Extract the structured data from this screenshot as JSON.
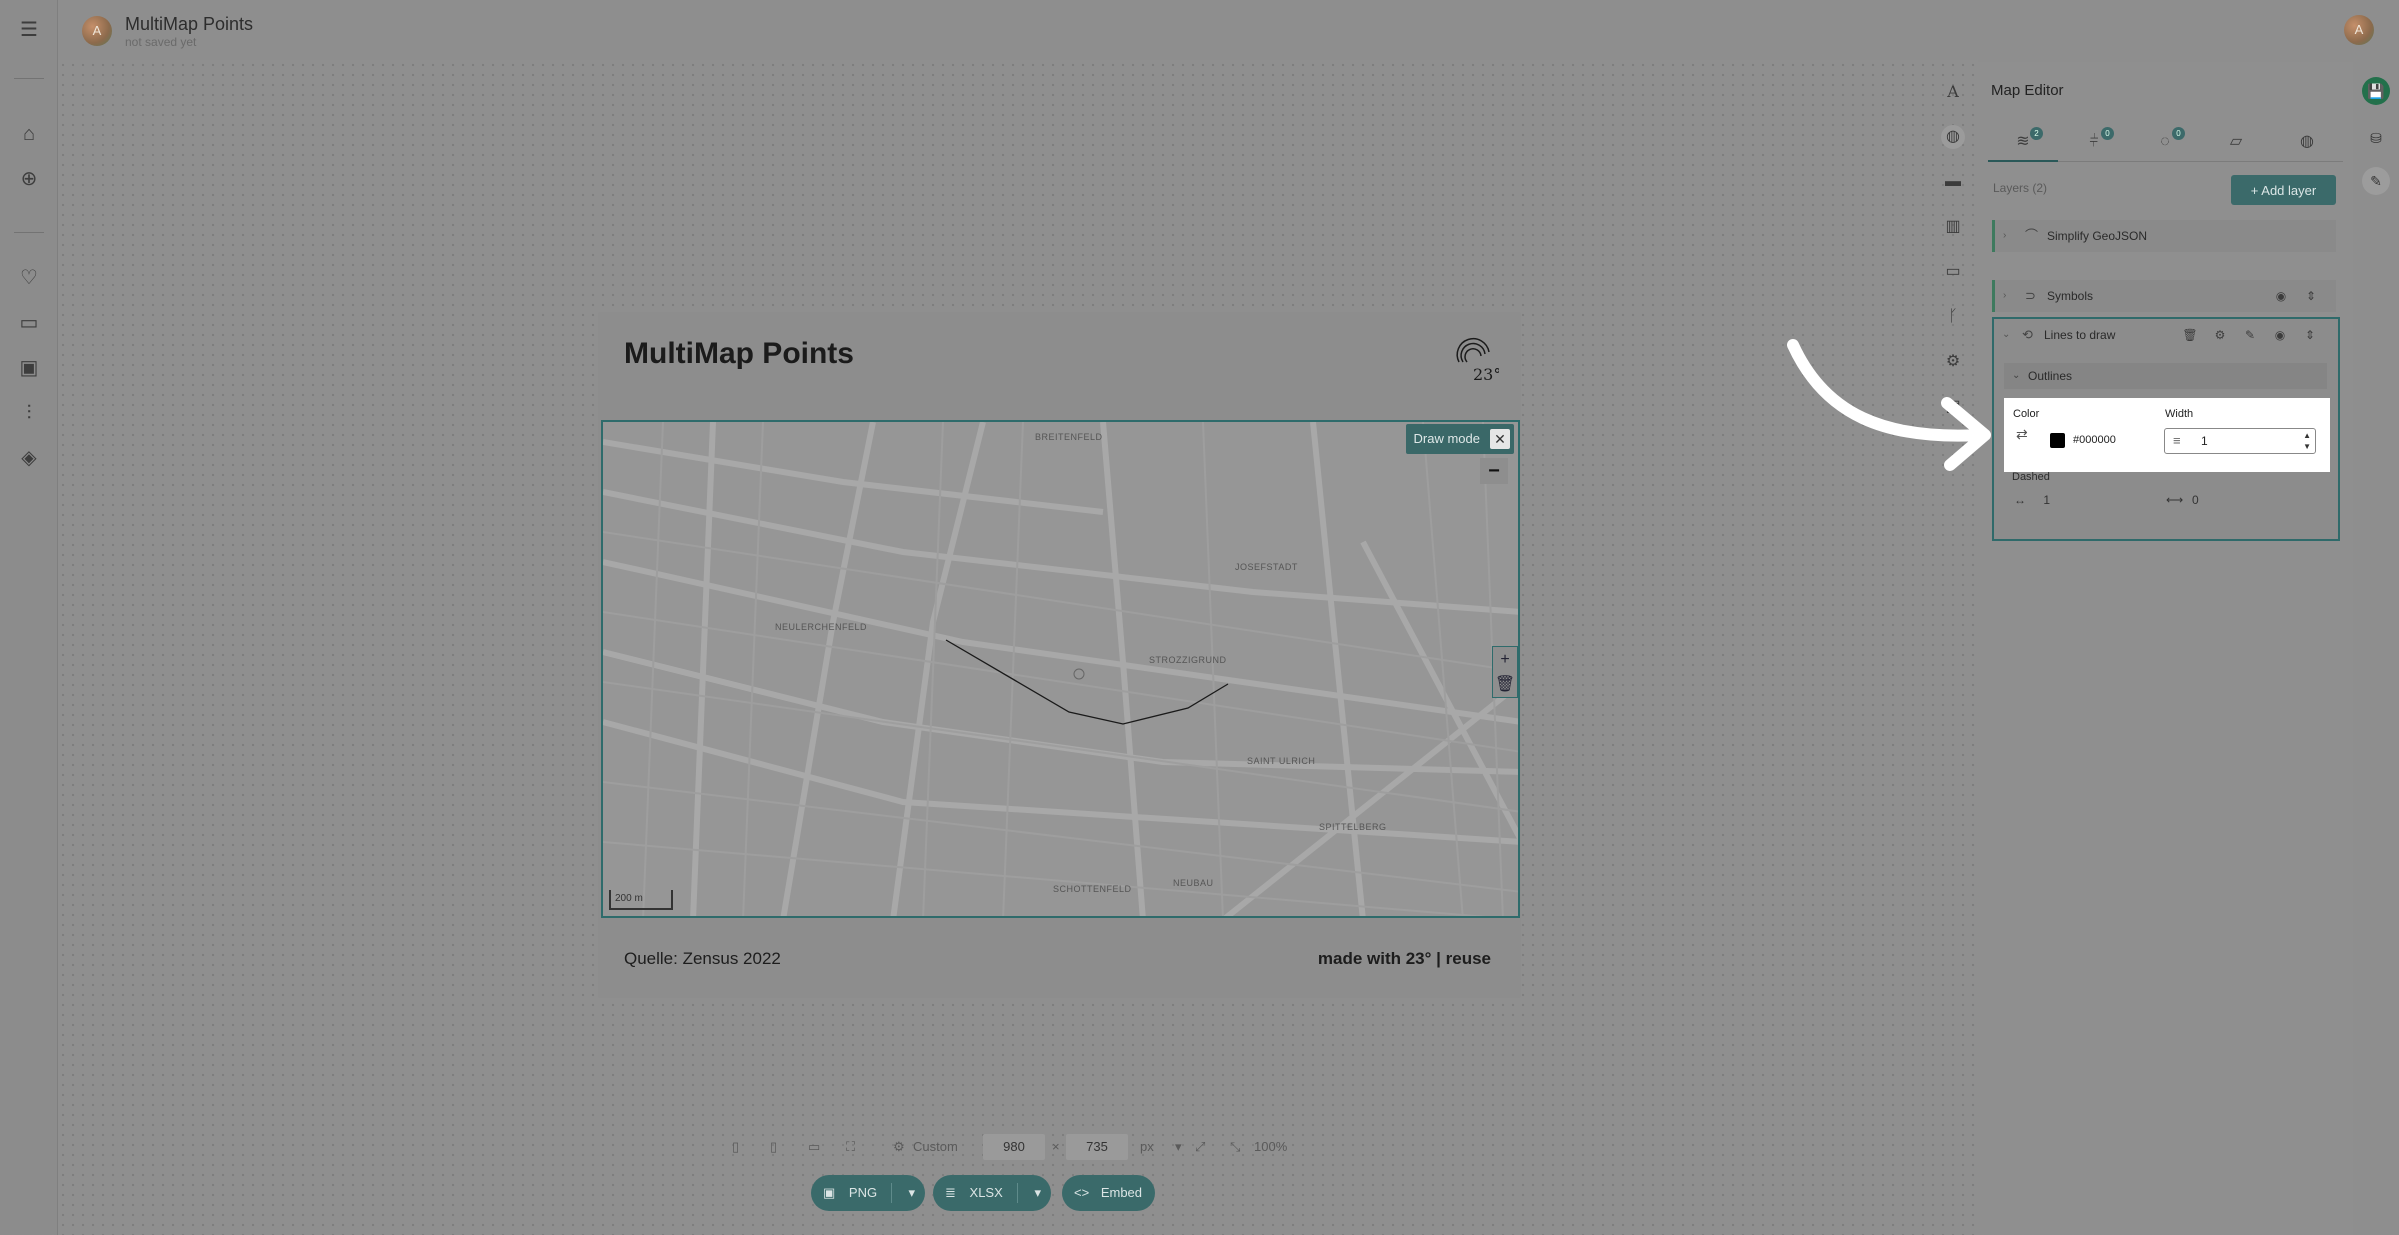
{
  "topbar": {
    "avatar_initial": "A",
    "title": "MultiMap Points",
    "subtitle": "not saved yet",
    "user_avatar_initial": "A"
  },
  "rail": {
    "items": [
      "menu-icon",
      "home-icon",
      "add-icon",
      "heart-icon",
      "folder-icon",
      "image-icon",
      "sliders-icon",
      "layers-icon"
    ]
  },
  "card": {
    "title": "MultiMap Points",
    "logo_text": "23°",
    "source": "Quelle: Zensus 2022",
    "made_with": "made with 23° | reuse"
  },
  "map": {
    "draw_mode_label": "Draw mode",
    "close_symbol": "✕",
    "zoom_minus": "−",
    "tool_plus": "+",
    "scale_label": "200 m",
    "labels": [
      "BREITENFELD",
      "JOSEFSTADT",
      "NEULERCHENFELD",
      "STROZZIGRUND",
      "SAINT ULRICH",
      "SPITTELBERG",
      "SCHOTTENFELD",
      "NEUBAU"
    ]
  },
  "editor": {
    "title": "Map Editor",
    "tabs": [
      {
        "icon": "layers-icon",
        "badge": "2"
      },
      {
        "icon": "filter-icon",
        "badge": "0"
      },
      {
        "icon": "legend-icon",
        "badge": "0"
      },
      {
        "icon": "map-icon",
        "badge": ""
      },
      {
        "icon": "globe-icon",
        "badge": ""
      }
    ],
    "layers_label": "Layers (2)",
    "add_layer_label": "+ Add layer",
    "layers": [
      {
        "name": "Simplify GeoJSON"
      },
      {
        "name": "Symbols"
      },
      {
        "name": "Lines to draw"
      }
    ],
    "outlines_label": "Outlines",
    "color_label": "Color",
    "color_value": "#000000",
    "width_label": "Width",
    "width_value": "1",
    "dashed_label": "Dashed",
    "dash_length": "1",
    "dash_gap": "0"
  },
  "bottom": {
    "preset_label": "Custom",
    "width": "980",
    "times": "×",
    "height": "735",
    "unit": "px",
    "zoom": "100%",
    "export_png": "PNG",
    "export_xlsx": "XLSX",
    "embed": "Embed"
  },
  "colors": {
    "accent": "#3a6a6a",
    "save": "#23704b"
  }
}
